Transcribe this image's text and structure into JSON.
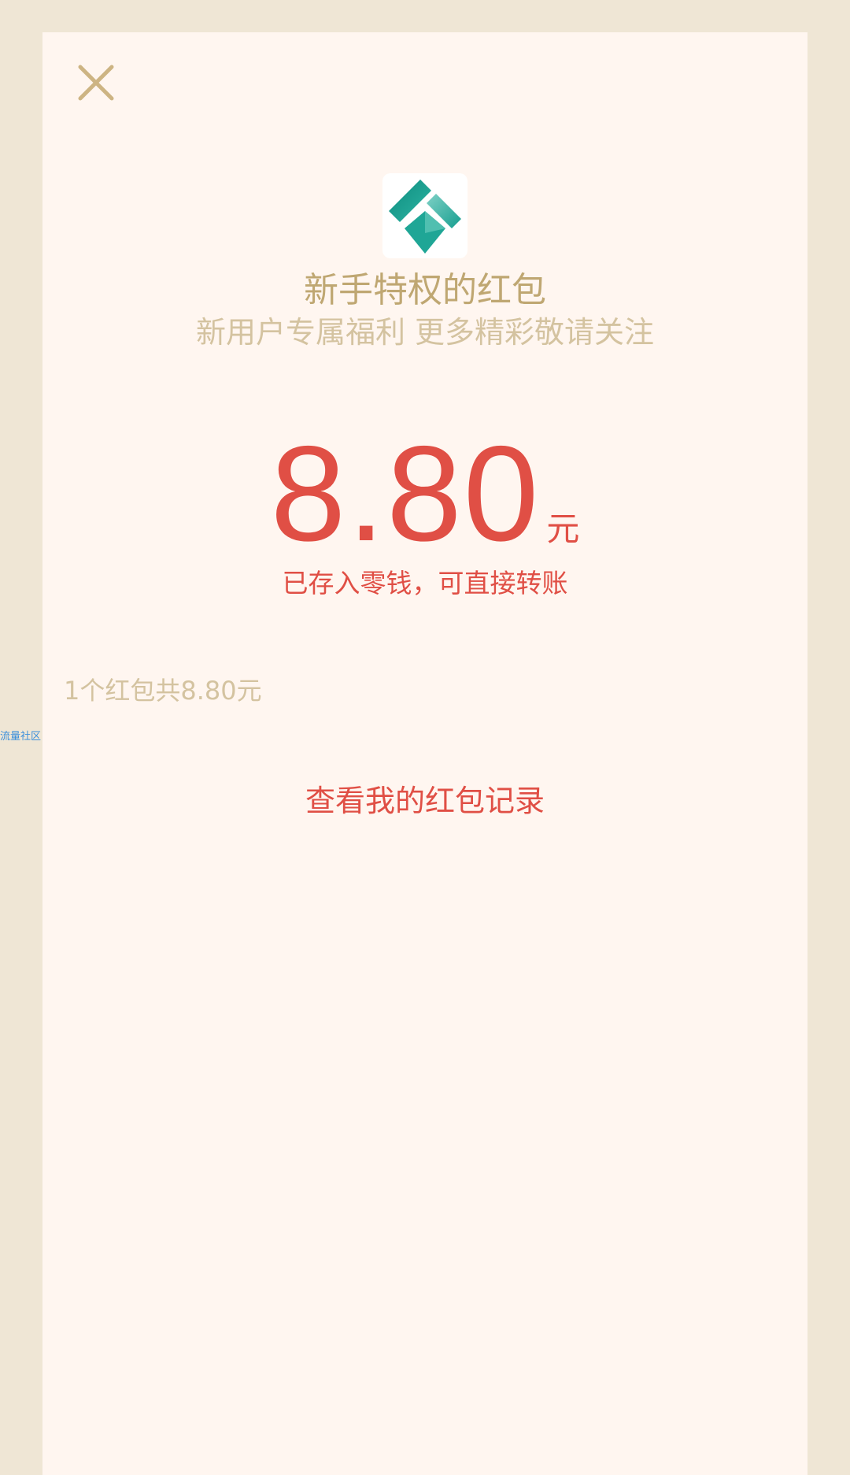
{
  "dialog": {
    "close_icon": "close-icon",
    "logo_icon": "app-logo-icon",
    "title": "新手特权的红包",
    "subtitle": "新用户专属福利 更多精彩敬请关注",
    "amount": "8.80",
    "amount_unit": "元",
    "stored_note": "已存入零钱，可直接转账",
    "summary": "1个红包共8.80元",
    "record_link": "查看我的红包记录"
  },
  "watermark": "流量社区",
  "colors": {
    "outer_background": "#EFE6D5",
    "panel_background": "#FFF6F0",
    "accent_red": "#E04F45",
    "gold_text": "#BFA772",
    "light_gold_text": "#D4C3A0",
    "logo_teal": "#169E8F",
    "watermark_blue": "#3B8FDB"
  }
}
